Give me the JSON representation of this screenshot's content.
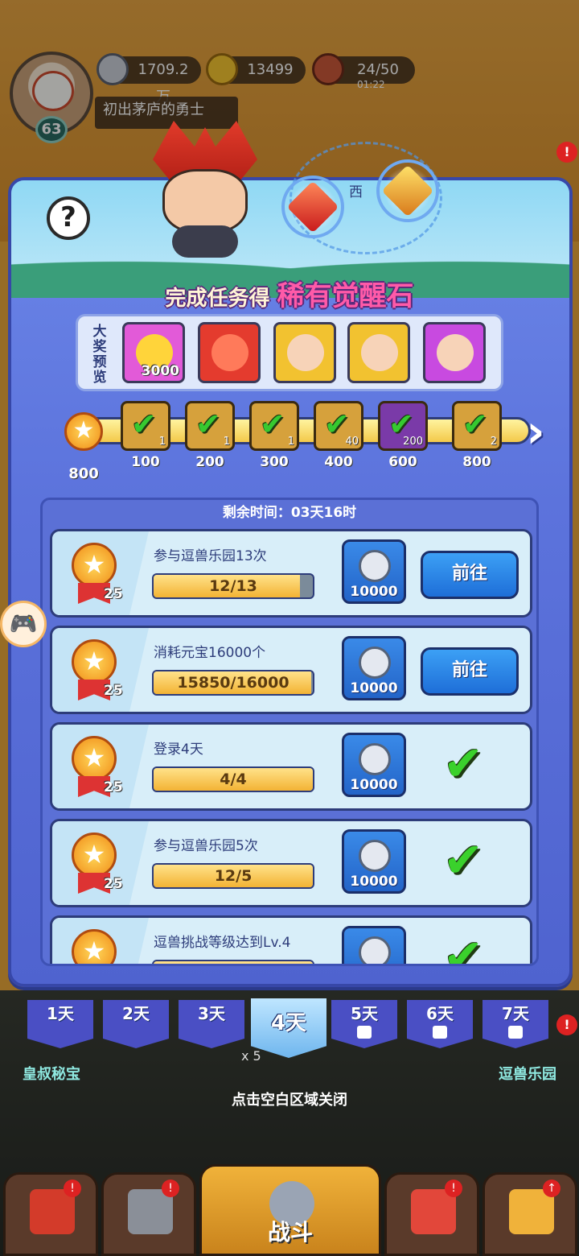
{
  "hud": {
    "level": "63",
    "silver": "1709.2万",
    "gold": "13499",
    "stamina": "24/50",
    "stamina_timer": "01:22",
    "player_title": "初出茅庐的勇士"
  },
  "panel": {
    "headline_prefix": "完成任务得",
    "headline_highlight": "稀有觉醒石",
    "stone_label": "西",
    "help_label": "?",
    "preview_label": "大奖预览",
    "preview_items": [
      {
        "name": "gold-ingot",
        "qty": "3000",
        "color": "#e25ad8"
      },
      {
        "name": "mystery-puzzle",
        "qty": "",
        "color": "#e43b2e"
      },
      {
        "name": "hero-portrait-1",
        "qty": "",
        "color": "#f2c230"
      },
      {
        "name": "hero-portrait-2",
        "qty": "",
        "color": "#f2c230"
      },
      {
        "name": "hero-portrait-3",
        "qty": "",
        "color": "#c84ae0"
      }
    ],
    "progress_start": "800",
    "milestones": [
      {
        "points": "100",
        "qty": "1",
        "purple": false
      },
      {
        "points": "200",
        "qty": "1",
        "purple": false
      },
      {
        "points": "300",
        "qty": "1",
        "purple": false
      },
      {
        "points": "400",
        "qty": "40",
        "purple": false
      },
      {
        "points": "600",
        "qty": "200",
        "purple": true
      },
      {
        "points": "800",
        "qty": "2",
        "purple": false
      }
    ],
    "remaining_time": "剩余时间：03天16时"
  },
  "tasks": [
    {
      "name": "参与逗兽乐园13次",
      "progress": "12/13",
      "ratio": 0.92,
      "points": "25",
      "reward": "10000",
      "action": "前往",
      "done": false
    },
    {
      "name": "消耗元宝16000个",
      "progress": "15850/16000",
      "ratio": 0.99,
      "points": "25",
      "reward": "10000",
      "action": "前往",
      "done": false
    },
    {
      "name": "登录4天",
      "progress": "4/4",
      "ratio": 1.0,
      "points": "25",
      "reward": "10000",
      "action": "",
      "done": true
    },
    {
      "name": "参与逗兽乐园5次",
      "progress": "12/5",
      "ratio": 1.0,
      "points": "25",
      "reward": "10000",
      "action": "",
      "done": true
    },
    {
      "name": "逗兽挑战等级达到Lv.4",
      "progress": "",
      "ratio": 1.0,
      "points": "",
      "reward": "",
      "action": "",
      "done": true
    }
  ],
  "days": [
    {
      "label": "1天",
      "locked": false
    },
    {
      "label": "2天",
      "locked": false
    },
    {
      "label": "3天",
      "locked": false
    },
    {
      "label": "4天",
      "locked": false,
      "active": true
    },
    {
      "label": "5天",
      "locked": true
    },
    {
      "label": "6天",
      "locked": true
    },
    {
      "label": "7天",
      "locked": true
    }
  ],
  "side_left": "皇叔秘宝",
  "side_right": "逗兽乐园",
  "close_hint": "点击空白区域关闭",
  "multiplier": "x 5",
  "bottom_nav": {
    "battle": "战斗"
  },
  "colors": {
    "panel": "#5c73dc",
    "accent_pink": "#ff5aa8",
    "check_green": "#3ad12c",
    "go_blue": "#1e6ed8"
  }
}
